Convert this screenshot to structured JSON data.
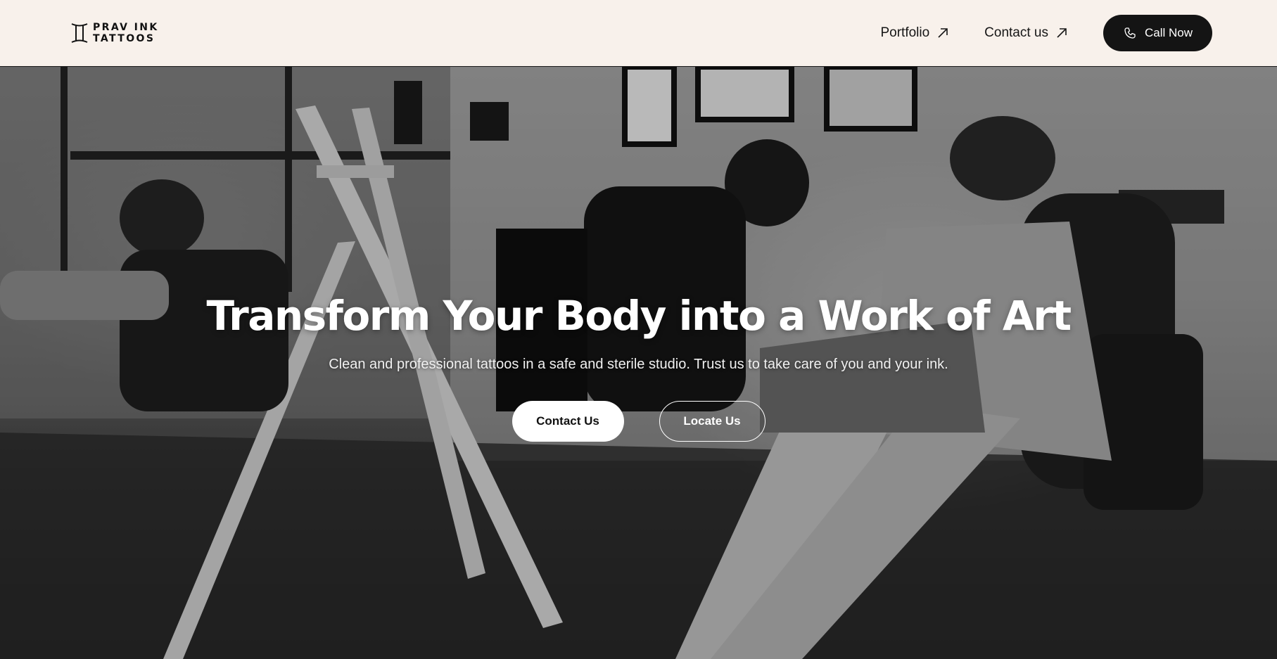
{
  "brand": {
    "line1": "PRAV INK",
    "line2": "TATTOOS",
    "logo_icon": "gemini-pillar-icon"
  },
  "nav": {
    "items": [
      {
        "label": "Portfolio",
        "icon": "arrow-up-right-icon"
      },
      {
        "label": "Contact us",
        "icon": "arrow-up-right-icon"
      }
    ],
    "call": {
      "label": "Call Now",
      "icon": "phone-icon"
    }
  },
  "hero": {
    "title": "Transform Your Body into a Work of Art",
    "subtitle": "Clean and professional tattoos in a safe and sterile studio. Trust us to take care of you and your ink.",
    "primary_button": "Contact Us",
    "secondary_button": "Locate Us"
  },
  "colors": {
    "header_bg": "#f8f1eb",
    "dark": "#141414",
    "white": "#ffffff"
  }
}
